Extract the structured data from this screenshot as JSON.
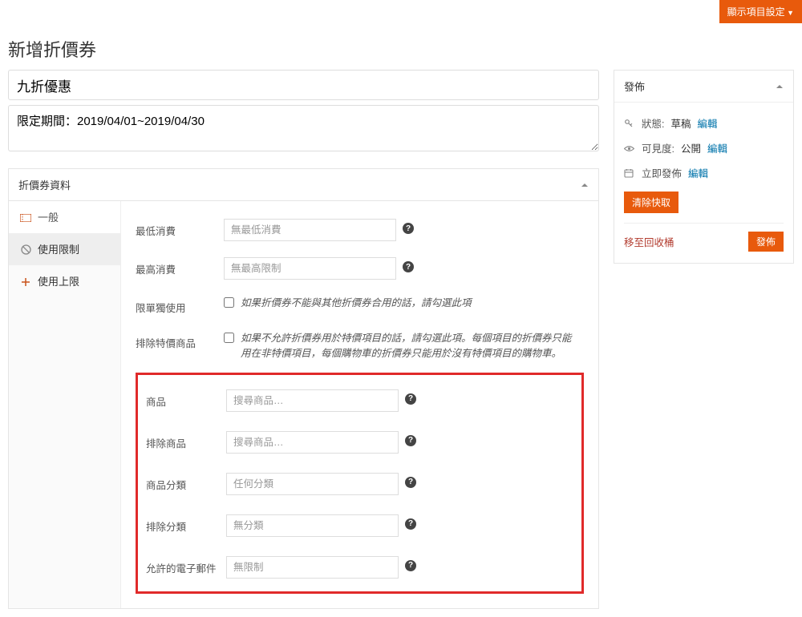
{
  "topbar": {
    "display_settings": "顯示項目設定"
  },
  "heading": "新增折價券",
  "title_value": "九折優惠",
  "description_value": "限定期間：2019/04/01~2019/04/30",
  "panel": {
    "title": "折價券資料",
    "tabs": {
      "general": "一般",
      "usage_restriction": "使用限制",
      "usage_limit": "使用上限"
    },
    "fields": {
      "min_spend_label": "最低消費",
      "min_spend_placeholder": "無最低消費",
      "max_spend_label": "最高消費",
      "max_spend_placeholder": "無最高限制",
      "individual_use_label": "限單獨使用",
      "individual_use_hint": "如果折價券不能與其他折價券合用的話，請勾選此項",
      "exclude_sale_label": "排除特價商品",
      "exclude_sale_hint": "如果不允許折價券用於特價項目的話，請勾選此項。每個項目的折價券只能用在非特價項目，每個購物車的折價券只能用於沒有特價項目的購物車。",
      "products_label": "商品",
      "products_placeholder": "搜尋商品…",
      "exclude_products_label": "排除商品",
      "exclude_products_placeholder": "搜尋商品…",
      "categories_label": "商品分類",
      "categories_placeholder": "任何分類",
      "exclude_categories_label": "排除分類",
      "exclude_categories_placeholder": "無分類",
      "allowed_emails_label": "允許的電子郵件",
      "allowed_emails_placeholder": "無限制"
    }
  },
  "publish": {
    "title": "發佈",
    "status_label": "狀態:",
    "status_value": "草稿",
    "visibility_label": "可見度:",
    "visibility_value": "公開",
    "schedule_label": "立即發佈",
    "edit": "編輯",
    "clear_cache": "清除快取",
    "trash": "移至回收桶",
    "publish_button": "發佈"
  }
}
